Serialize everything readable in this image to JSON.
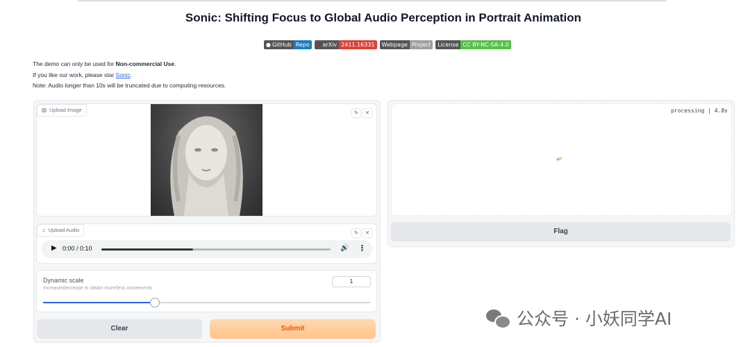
{
  "header": {
    "title": "Sonic: Shifting Focus to Global Audio Perception in Portrait Animation"
  },
  "badges": [
    {
      "label": "GitHub",
      "value": "Repo",
      "color": "#1e7bc0"
    },
    {
      "label": "arXiv",
      "value": "2411.16331",
      "color": "#d9433a"
    },
    {
      "label": "Webpage",
      "value": "Project",
      "color": "#9e9e9e"
    },
    {
      "label": "License",
      "value": "CC BY-NC-SA-4.0",
      "color": "#54c246"
    }
  ],
  "info": {
    "line1_prefix": "The demo can only be used for ",
    "line1_bold": "Non-commercial Use",
    "line1_suffix": ".",
    "line2_prefix": "If you like our work, please star ",
    "line2_link": "Sonic",
    "line2_suffix": ".",
    "line3": "Note: Audio longer than 10s will be truncated due to computing resources."
  },
  "upload_image": {
    "label": "Upload Image"
  },
  "upload_audio": {
    "label": "Upload Audio"
  },
  "audio_player": {
    "time": "0:00 / 0:10",
    "progress": 0.4
  },
  "slider": {
    "label": "Dynamic scale",
    "info": "Increase/decrease to obtain more/less movements",
    "value": "1",
    "fill_fraction": 0.34
  },
  "buttons": {
    "clear": "Clear",
    "submit": "Submit",
    "flag": "Flag"
  },
  "output": {
    "status": "processing | 4.8s"
  },
  "watermark": {
    "text": "公众号 · 小妖同学AI"
  },
  "colors": {
    "accent": "#ff7c00",
    "submit_bg": "#ffcf9d",
    "slider": "#2563eb"
  }
}
